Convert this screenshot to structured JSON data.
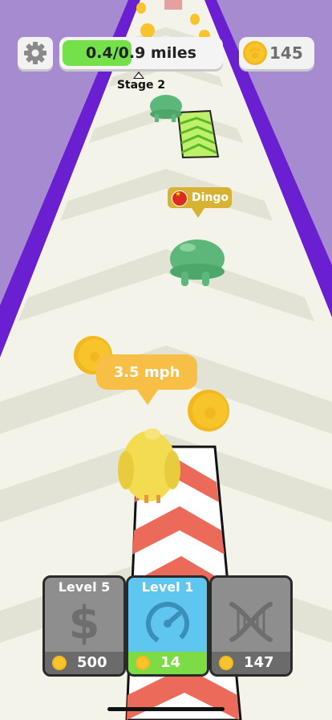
{
  "hud": {
    "progress_text": "0.4/0.9 miles",
    "progress_fraction": 0.44,
    "coins": "145",
    "stage_label": "Stage 2"
  },
  "rival": {
    "name": "Dingo",
    "flag": "china-flag-icon"
  },
  "player": {
    "speed_text": "3.5 mph"
  },
  "upgrades": [
    {
      "label": "Level 5",
      "cost": "500",
      "icon": "dollar-icon"
    },
    {
      "label": "Level 1",
      "cost": "14",
      "icon": "speedometer-icon"
    },
    {
      "label": "",
      "cost": "147",
      "icon": "dna-icon"
    }
  ],
  "colors": {
    "wall": "#6a1fd0",
    "background": "#a78bd0",
    "track": "#f3f3ea",
    "lane_stripe": "#ec6a5a",
    "progress_fill": "#74e04a",
    "coin": "#f7c52b",
    "slime": "#5db77a",
    "player": "#f3dc52"
  }
}
